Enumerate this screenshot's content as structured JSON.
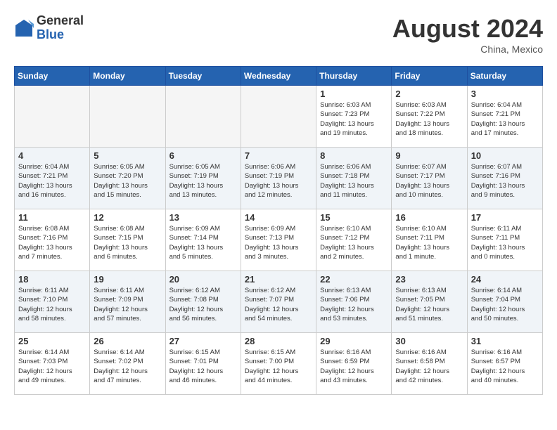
{
  "header": {
    "logo_general": "General",
    "logo_blue": "Blue",
    "month_title": "August 2024",
    "location": "China, Mexico"
  },
  "weekdays": [
    "Sunday",
    "Monday",
    "Tuesday",
    "Wednesday",
    "Thursday",
    "Friday",
    "Saturday"
  ],
  "weeks": [
    [
      {
        "day": "",
        "info": ""
      },
      {
        "day": "",
        "info": ""
      },
      {
        "day": "",
        "info": ""
      },
      {
        "day": "",
        "info": ""
      },
      {
        "day": "1",
        "info": "Sunrise: 6:03 AM\nSunset: 7:23 PM\nDaylight: 13 hours\nand 19 minutes."
      },
      {
        "day": "2",
        "info": "Sunrise: 6:03 AM\nSunset: 7:22 PM\nDaylight: 13 hours\nand 18 minutes."
      },
      {
        "day": "3",
        "info": "Sunrise: 6:04 AM\nSunset: 7:21 PM\nDaylight: 13 hours\nand 17 minutes."
      }
    ],
    [
      {
        "day": "4",
        "info": "Sunrise: 6:04 AM\nSunset: 7:21 PM\nDaylight: 13 hours\nand 16 minutes."
      },
      {
        "day": "5",
        "info": "Sunrise: 6:05 AM\nSunset: 7:20 PM\nDaylight: 13 hours\nand 15 minutes."
      },
      {
        "day": "6",
        "info": "Sunrise: 6:05 AM\nSunset: 7:19 PM\nDaylight: 13 hours\nand 13 minutes."
      },
      {
        "day": "7",
        "info": "Sunrise: 6:06 AM\nSunset: 7:19 PM\nDaylight: 13 hours\nand 12 minutes."
      },
      {
        "day": "8",
        "info": "Sunrise: 6:06 AM\nSunset: 7:18 PM\nDaylight: 13 hours\nand 11 minutes."
      },
      {
        "day": "9",
        "info": "Sunrise: 6:07 AM\nSunset: 7:17 PM\nDaylight: 13 hours\nand 10 minutes."
      },
      {
        "day": "10",
        "info": "Sunrise: 6:07 AM\nSunset: 7:16 PM\nDaylight: 13 hours\nand 9 minutes."
      }
    ],
    [
      {
        "day": "11",
        "info": "Sunrise: 6:08 AM\nSunset: 7:16 PM\nDaylight: 13 hours\nand 7 minutes."
      },
      {
        "day": "12",
        "info": "Sunrise: 6:08 AM\nSunset: 7:15 PM\nDaylight: 13 hours\nand 6 minutes."
      },
      {
        "day": "13",
        "info": "Sunrise: 6:09 AM\nSunset: 7:14 PM\nDaylight: 13 hours\nand 5 minutes."
      },
      {
        "day": "14",
        "info": "Sunrise: 6:09 AM\nSunset: 7:13 PM\nDaylight: 13 hours\nand 3 minutes."
      },
      {
        "day": "15",
        "info": "Sunrise: 6:10 AM\nSunset: 7:12 PM\nDaylight: 13 hours\nand 2 minutes."
      },
      {
        "day": "16",
        "info": "Sunrise: 6:10 AM\nSunset: 7:11 PM\nDaylight: 13 hours\nand 1 minute."
      },
      {
        "day": "17",
        "info": "Sunrise: 6:11 AM\nSunset: 7:11 PM\nDaylight: 13 hours\nand 0 minutes."
      }
    ],
    [
      {
        "day": "18",
        "info": "Sunrise: 6:11 AM\nSunset: 7:10 PM\nDaylight: 12 hours\nand 58 minutes."
      },
      {
        "day": "19",
        "info": "Sunrise: 6:11 AM\nSunset: 7:09 PM\nDaylight: 12 hours\nand 57 minutes."
      },
      {
        "day": "20",
        "info": "Sunrise: 6:12 AM\nSunset: 7:08 PM\nDaylight: 12 hours\nand 56 minutes."
      },
      {
        "day": "21",
        "info": "Sunrise: 6:12 AM\nSunset: 7:07 PM\nDaylight: 12 hours\nand 54 minutes."
      },
      {
        "day": "22",
        "info": "Sunrise: 6:13 AM\nSunset: 7:06 PM\nDaylight: 12 hours\nand 53 minutes."
      },
      {
        "day": "23",
        "info": "Sunrise: 6:13 AM\nSunset: 7:05 PM\nDaylight: 12 hours\nand 51 minutes."
      },
      {
        "day": "24",
        "info": "Sunrise: 6:14 AM\nSunset: 7:04 PM\nDaylight: 12 hours\nand 50 minutes."
      }
    ],
    [
      {
        "day": "25",
        "info": "Sunrise: 6:14 AM\nSunset: 7:03 PM\nDaylight: 12 hours\nand 49 minutes."
      },
      {
        "day": "26",
        "info": "Sunrise: 6:14 AM\nSunset: 7:02 PM\nDaylight: 12 hours\nand 47 minutes."
      },
      {
        "day": "27",
        "info": "Sunrise: 6:15 AM\nSunset: 7:01 PM\nDaylight: 12 hours\nand 46 minutes."
      },
      {
        "day": "28",
        "info": "Sunrise: 6:15 AM\nSunset: 7:00 PM\nDaylight: 12 hours\nand 44 minutes."
      },
      {
        "day": "29",
        "info": "Sunrise: 6:16 AM\nSunset: 6:59 PM\nDaylight: 12 hours\nand 43 minutes."
      },
      {
        "day": "30",
        "info": "Sunrise: 6:16 AM\nSunset: 6:58 PM\nDaylight: 12 hours\nand 42 minutes."
      },
      {
        "day": "31",
        "info": "Sunrise: 6:16 AM\nSunset: 6:57 PM\nDaylight: 12 hours\nand 40 minutes."
      }
    ]
  ]
}
